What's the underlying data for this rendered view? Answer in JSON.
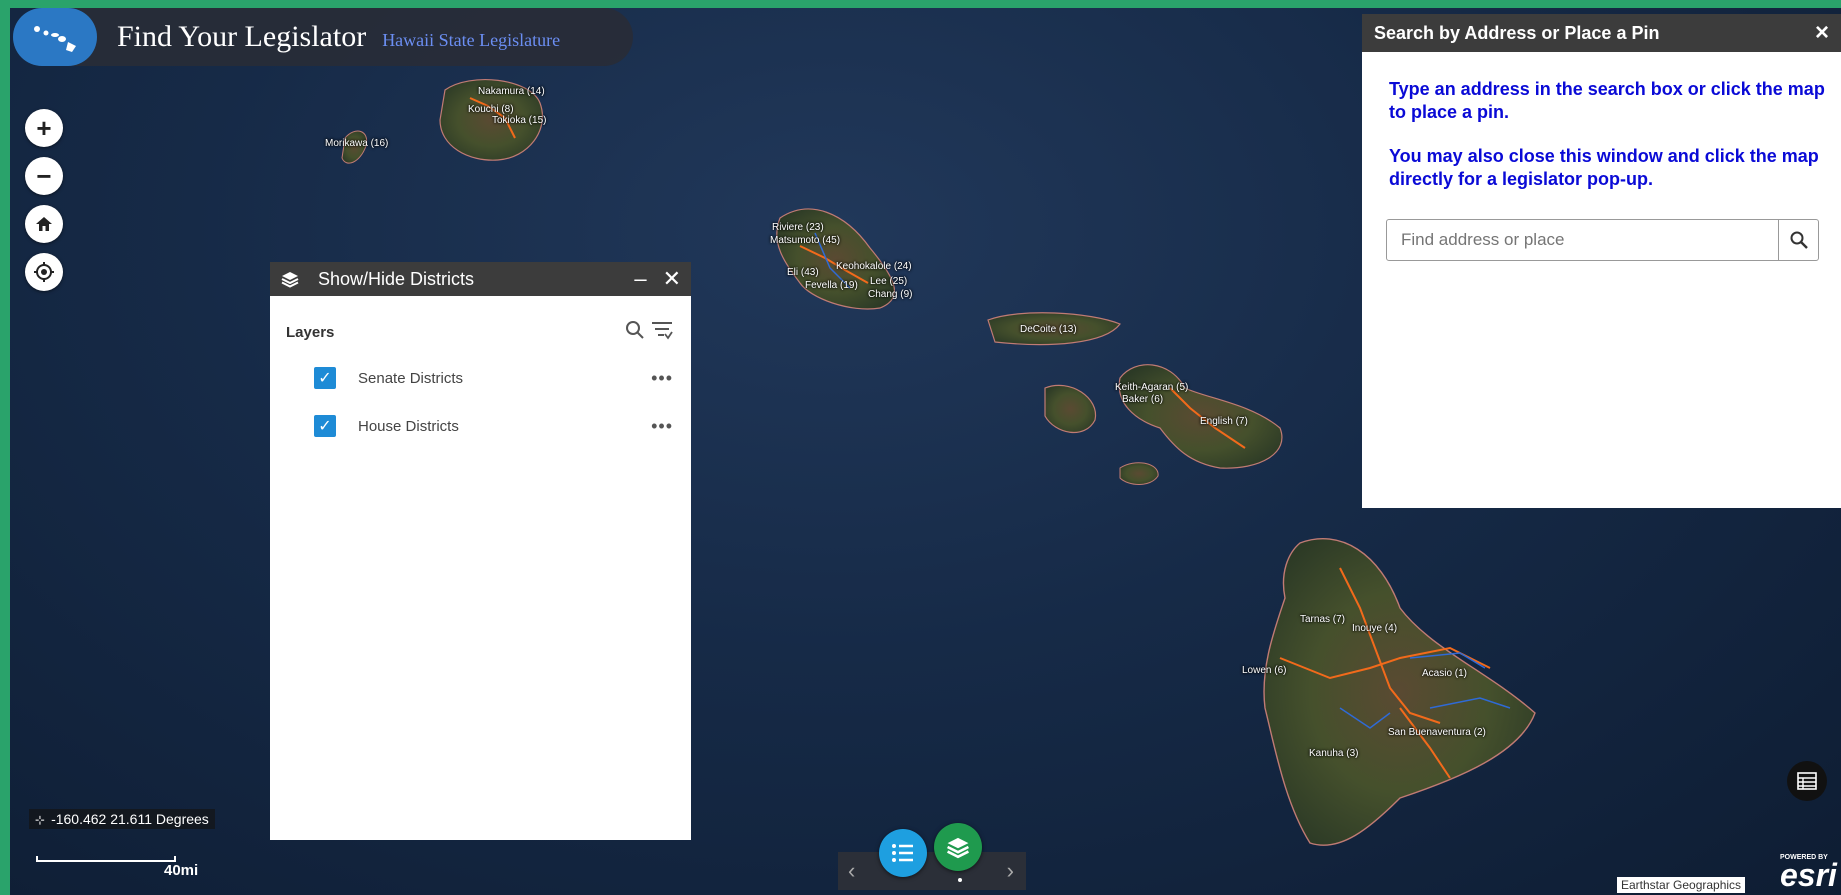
{
  "header": {
    "title": "Find Your Legislator",
    "subtitle": "Hawaii State Legislature",
    "logo_icon": "hawaii-islands-icon"
  },
  "map_controls": [
    {
      "name": "zoom-in",
      "glyph": "+"
    },
    {
      "name": "zoom-out",
      "glyph": "−"
    },
    {
      "name": "home",
      "glyph": "⌂"
    },
    {
      "name": "locate",
      "glyph": "◎"
    }
  ],
  "district_labels": [
    "Nakamura (14)",
    "Kouchi (8)",
    "Tokioka (15)",
    "Morikawa (16)",
    "Riviere (23)",
    "Matsumoto (45)",
    "Eli (43)",
    "Fevella (19)",
    "Keohokalole (24)",
    "Lee (25)",
    "Chang (9)",
    "DeCoite (13)",
    "Keith-Agaran (5)",
    "Baker (6)",
    "English (7)",
    "Tarnas (7)",
    "Inouye (4)",
    "Lowen (6)",
    "Acasio (1)",
    "San Buenaventura (2)",
    "Kanuha (3)"
  ],
  "layers_panel": {
    "title": "Show/Hide Districts",
    "minimize": "–",
    "close": "✕",
    "section_label": "Layers",
    "layers": [
      {
        "name": "Senate Districts",
        "checked": true
      },
      {
        "name": "House Districts",
        "checked": true
      }
    ],
    "more_glyph": "•••"
  },
  "search_panel": {
    "title": "Search by Address or Place a Pin",
    "close": "×",
    "instruction_1": "Type an address in the search box or click the map to place a pin.",
    "instruction_2": "You may also close this window and click the map directly for a legislator pop-up.",
    "placeholder": "Find address or place"
  },
  "coordinates": "-160.462 21.611 Degrees",
  "scale_label": "40mi",
  "attribution": "Earthstar Geographics",
  "esri": {
    "powered_by": "POWERED BY",
    "brand": "esri"
  },
  "colors": {
    "house_boundary": "#f26a1b",
    "senate_boundary": "#2f6ad6",
    "legend_btn": "#1e9fe0",
    "layers_btn": "#1f9a4e",
    "checkbox": "#1e8bd6"
  }
}
